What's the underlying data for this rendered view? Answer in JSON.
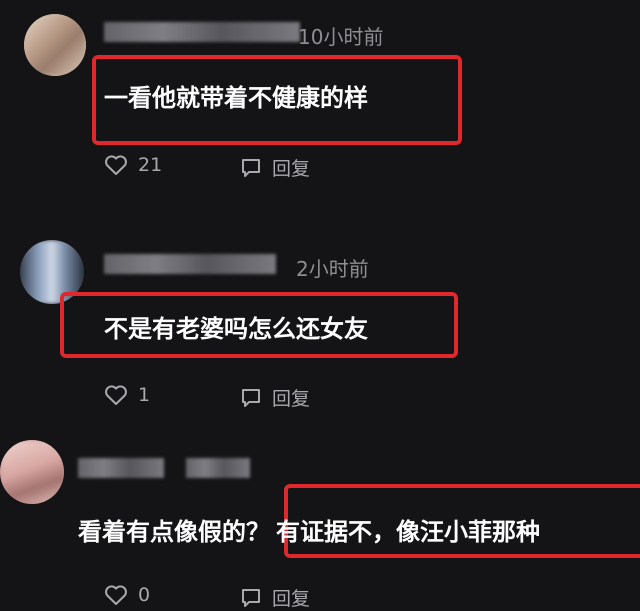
{
  "comments": [
    {
      "time": "10小时前",
      "text": "一看他就带着不健康的样",
      "likes": "21",
      "reply_label": "回复"
    },
    {
      "time": "2小时前",
      "text": "不是有老婆吗怎么还女友",
      "likes": "1",
      "reply_label": "回复"
    },
    {
      "time": "",
      "text_plain": "看着有点像假的？",
      "text_boxed": "有证据不，像汪小菲那种",
      "likes": "0",
      "reply_label": "回复"
    }
  ],
  "colors": {
    "background": "#141416",
    "highlight_border": "#e0282c",
    "meta_text": "#8e8e93"
  },
  "icons": [
    "heart-icon",
    "reply-bubble-icon"
  ]
}
